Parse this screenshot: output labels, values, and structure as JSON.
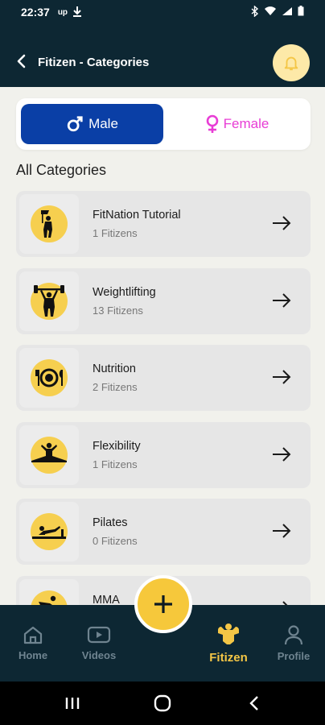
{
  "status_bar": {
    "time": "22:37",
    "left_icons": [
      "up-icon",
      "download-icon"
    ],
    "right_icons": [
      "bluetooth-icon",
      "wifi-icon",
      "signal-icon",
      "battery-icon"
    ]
  },
  "app_bar": {
    "title": "Fitizen - Categories"
  },
  "gender": {
    "male_label": "Male",
    "female_label": "Female",
    "selected": "Male"
  },
  "section_title": "All Categories",
  "categories": [
    {
      "name": "FitNation Tutorial",
      "count": "1 Fitizens",
      "icon": "flag-athlete-icon"
    },
    {
      "name": "Weightlifting",
      "count": "13 Fitizens",
      "icon": "weightlifter-icon"
    },
    {
      "name": "Nutrition",
      "count": "2 Fitizens",
      "icon": "plate-cutlery-icon"
    },
    {
      "name": "Flexibility",
      "count": "1 Fitizens",
      "icon": "split-pose-icon"
    },
    {
      "name": "Pilates",
      "count": "0 Fitizens",
      "icon": "pilates-icon"
    },
    {
      "name": "MMA",
      "count": "",
      "icon": "mma-icon"
    }
  ],
  "bottom_nav": {
    "items": [
      {
        "label": "Home",
        "icon": "home-icon"
      },
      {
        "label": "Videos",
        "icon": "video-icon"
      },
      {
        "label": "Fitizen",
        "icon": "fitizen-icon",
        "active": true
      },
      {
        "label": "Profile",
        "icon": "profile-icon"
      }
    ],
    "fab_icon": "plus-icon"
  },
  "colors": {
    "dark_navy": "#0d2733",
    "accent_yellow": "#f6c83b",
    "male_blue": "#0a3fa6",
    "female_pink": "#e83dd5"
  }
}
